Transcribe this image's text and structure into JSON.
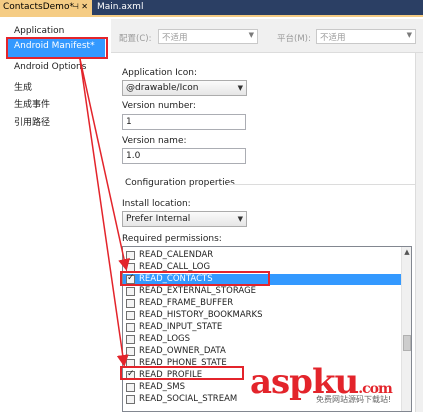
{
  "tabs": [
    {
      "label": "ContactsDemo*"
    },
    {
      "label": "Main.axml"
    }
  ],
  "sidebar": {
    "items": [
      {
        "label": "Application"
      },
      {
        "label": "Android Manifest*"
      },
      {
        "label": "Android Options"
      },
      {
        "label": "生成"
      },
      {
        "label": "生成事件"
      },
      {
        "label": "引用路径"
      }
    ],
    "selected_index": 1
  },
  "toolbar": {
    "config_label": "配置(C):",
    "config_value": "不适用",
    "platform_label": "平台(M):",
    "platform_value": "不适用"
  },
  "form": {
    "app_icon_label": "Application Icon:",
    "app_icon_value": "@drawable/Icon",
    "version_number_label": "Version number:",
    "version_number_value": "1",
    "version_name_label": "Version name:",
    "version_name_value": "1.0",
    "config_section_title": "Configuration properties",
    "install_location_label": "Install location:",
    "install_location_value": "Prefer Internal",
    "permissions_label": "Required permissions:"
  },
  "permissions": [
    {
      "name": "READ_CALENDAR",
      "checked": false,
      "selected": false
    },
    {
      "name": "READ_CALL_LOG",
      "checked": false,
      "selected": false
    },
    {
      "name": "READ_CONTACTS",
      "checked": true,
      "selected": true
    },
    {
      "name": "READ_EXTERNAL_STORAGE",
      "checked": false,
      "selected": false
    },
    {
      "name": "READ_FRAME_BUFFER",
      "checked": false,
      "selected": false
    },
    {
      "name": "READ_HISTORY_BOOKMARKS",
      "checked": false,
      "selected": false
    },
    {
      "name": "READ_INPUT_STATE",
      "checked": false,
      "selected": false
    },
    {
      "name": "READ_LOGS",
      "checked": false,
      "selected": false
    },
    {
      "name": "READ_OWNER_DATA",
      "checked": false,
      "selected": false
    },
    {
      "name": "READ_PHONE_STATE",
      "checked": false,
      "selected": false
    },
    {
      "name": "READ_PROFILE",
      "checked": true,
      "selected": false
    },
    {
      "name": "READ_SMS",
      "checked": false,
      "selected": false
    },
    {
      "name": "READ_SOCIAL_STREAM",
      "checked": false,
      "selected": false
    }
  ],
  "watermark": {
    "brand": "aspku.com",
    "tagline": "免费网站源码下载站!"
  },
  "colors": {
    "selection_blue": "#3399ff",
    "annotation_red": "#e3242b",
    "tab_active": "#f5cc84",
    "tab_strip": "#2b3f64"
  }
}
